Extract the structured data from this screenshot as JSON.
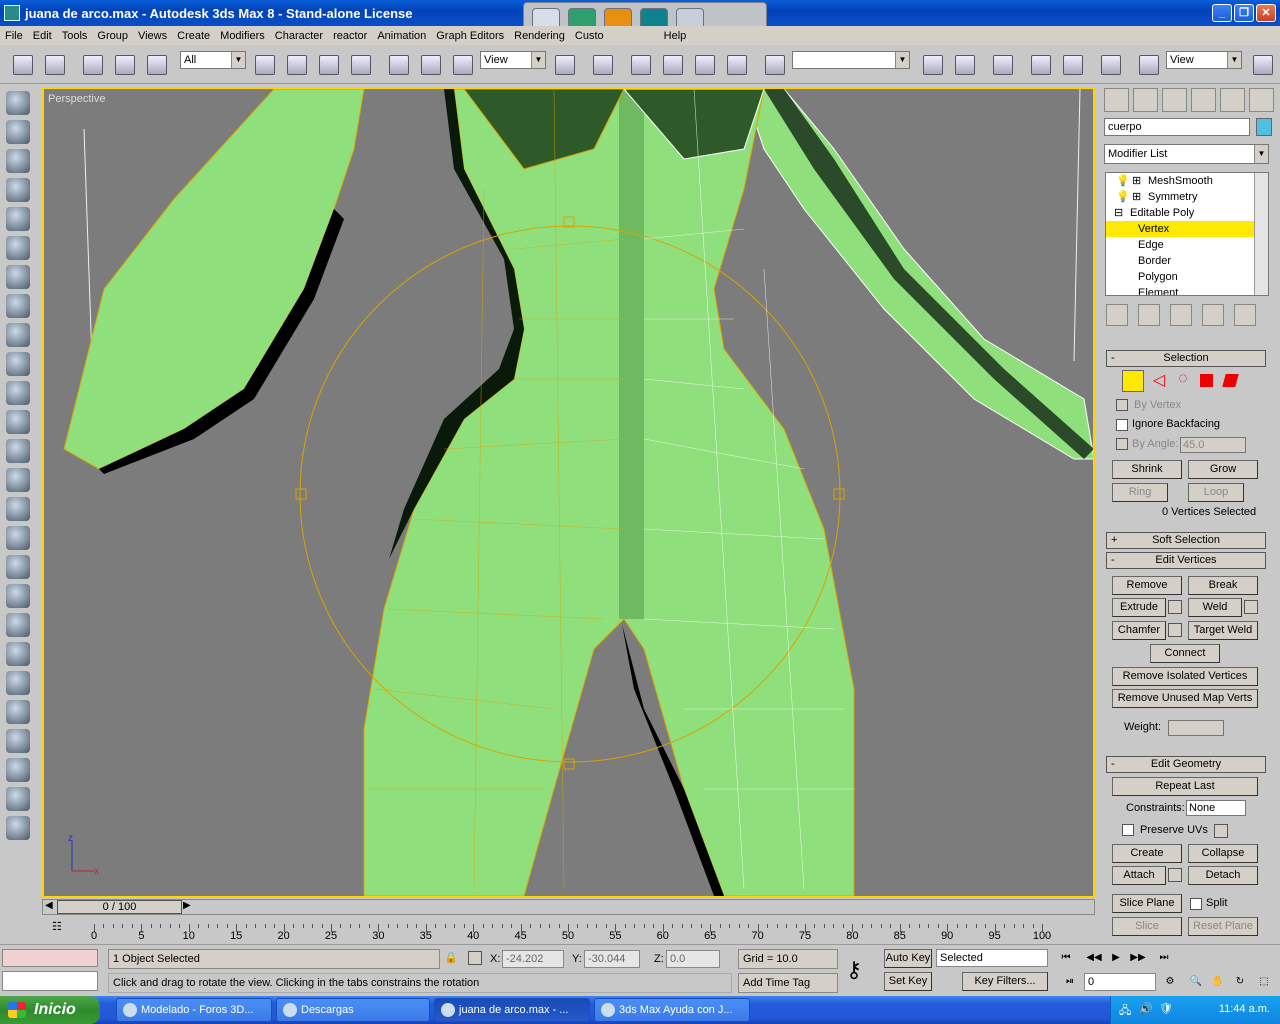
{
  "window": {
    "title": "juana de arco.max - Autodesk 3ds Max 8  - Stand-alone License"
  },
  "menu": [
    "File",
    "Edit",
    "Tools",
    "Group",
    "Views",
    "Create",
    "Modifiers",
    "Character",
    "reactor",
    "Animation",
    "Graph Editors",
    "Rendering",
    "Custo",
    "Help"
  ],
  "toolbar": {
    "filter": "All",
    "ref_coord": "View",
    "named_sel": "",
    "ref_coord2": "View",
    "snap_num": "3"
  },
  "viewport": {
    "label": "Perspective"
  },
  "command_panel": {
    "object_name": "cuerpo",
    "modifier_list": "Modifier List",
    "stack": [
      "MeshSmooth",
      "Symmetry",
      "Editable Poly",
      "Vertex",
      "Edge",
      "Border",
      "Polygon",
      "Element"
    ],
    "selection": {
      "title": "Selection",
      "by_vertex": "By Vertex",
      "ignore_backfacing": "Ignore Backfacing",
      "by_angle": "By Angle:",
      "angle": "45.0",
      "shrink": "Shrink",
      "grow": "Grow",
      "ring": "Ring",
      "loop": "Loop",
      "status": "0 Vertices Selected"
    },
    "soft_selection": {
      "title": "Soft Selection"
    },
    "edit_vertices": {
      "title": "Edit Vertices",
      "remove": "Remove",
      "break": "Break",
      "extrude": "Extrude",
      "weld": "Weld",
      "chamfer": "Chamfer",
      "target_weld": "Target Weld",
      "connect": "Connect",
      "remove_isolated": "Remove Isolated Vertices",
      "remove_unused": "Remove Unused Map Verts",
      "weight": "Weight:"
    },
    "edit_geometry": {
      "title": "Edit Geometry",
      "repeat_last": "Repeat Last",
      "constraints": "Constraints:",
      "constraints_value": "None",
      "preserve_uvs": "Preserve UVs",
      "create": "Create",
      "collapse": "Collapse",
      "attach": "Attach",
      "detach": "Detach",
      "slice_plane": "Slice Plane",
      "split": "Split",
      "slice": "Slice",
      "reset_plane": "Reset Plane"
    }
  },
  "timeline": {
    "slider": "0 / 100",
    "ticks": [
      "0",
      "5",
      "10",
      "15",
      "20",
      "25",
      "30",
      "35",
      "40",
      "45",
      "50",
      "55",
      "60",
      "65",
      "70",
      "75",
      "80",
      "85",
      "90",
      "95",
      "100"
    ]
  },
  "status": {
    "selected": "1 Object Selected",
    "prompt": "Click and drag to rotate the view.  Clicking in the tabs constrains the rotation",
    "x_label": "X:",
    "x": "-24.202",
    "y_label": "Y:",
    "y": "-30.044",
    "z_label": "Z:",
    "z": "0.0",
    "grid": "Grid = 10.0",
    "add_time_tag": "Add Time Tag",
    "auto_key": "Auto Key",
    "set_key": "Set Key",
    "selected_filter": "Selected",
    "key_filters": "Key Filters...",
    "frame": "0"
  },
  "taskbar": {
    "start": "Inicio",
    "items": [
      "Modelado - Foros 3D...",
      "Descargas",
      "juana de arco.max - ...",
      "3ds Max Ayuda con J..."
    ],
    "clock": "11:44 a.m."
  }
}
